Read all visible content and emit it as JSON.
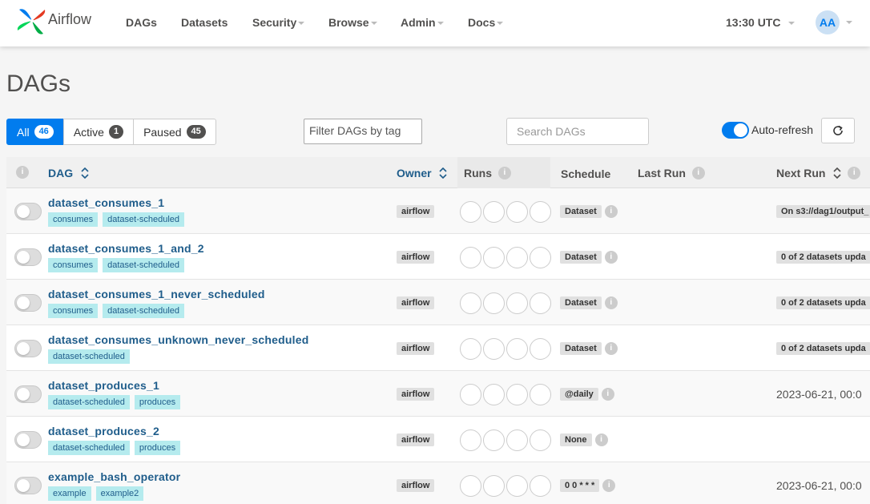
{
  "brand": {
    "name": "Airflow"
  },
  "nav": {
    "items": [
      {
        "label": "DAGs",
        "dropdown": false
      },
      {
        "label": "Datasets",
        "dropdown": false
      },
      {
        "label": "Security",
        "dropdown": true
      },
      {
        "label": "Browse",
        "dropdown": true
      },
      {
        "label": "Admin",
        "dropdown": true
      },
      {
        "label": "Docs",
        "dropdown": true
      }
    ],
    "clock": "13:30 UTC",
    "avatar_initials": "AA"
  },
  "page": {
    "title": "DAGs"
  },
  "filters": {
    "status": [
      {
        "label": "All",
        "count": "46",
        "active": true
      },
      {
        "label": "Active",
        "count": "1",
        "active": false
      },
      {
        "label": "Paused",
        "count": "45",
        "active": false
      }
    ],
    "tag_placeholder": "Filter DAGs by tag",
    "search_placeholder": "Search DAGs",
    "auto_refresh_label": "Auto-refresh",
    "auto_refresh_on": true
  },
  "table": {
    "headers": {
      "info": "i",
      "dag": "DAG",
      "owner": "Owner",
      "runs": "Runs",
      "schedule": "Schedule",
      "last_run": "Last Run",
      "next_run": "Next Run"
    },
    "rows": [
      {
        "name": "dataset_consumes_1",
        "tags": [
          "consumes",
          "dataset-scheduled"
        ],
        "owner": "airflow",
        "schedule": "Dataset",
        "next_run": "On s3://dag1/output_",
        "next_run_badge": true
      },
      {
        "name": "dataset_consumes_1_and_2",
        "tags": [
          "consumes",
          "dataset-scheduled"
        ],
        "owner": "airflow",
        "schedule": "Dataset",
        "next_run": "0 of 2 datasets upda",
        "next_run_badge": true
      },
      {
        "name": "dataset_consumes_1_never_scheduled",
        "tags": [
          "consumes",
          "dataset-scheduled"
        ],
        "owner": "airflow",
        "schedule": "Dataset",
        "next_run": "0 of 2 datasets upda",
        "next_run_badge": true
      },
      {
        "name": "dataset_consumes_unknown_never_scheduled",
        "tags": [
          "dataset-scheduled"
        ],
        "owner": "airflow",
        "schedule": "Dataset",
        "next_run": "0 of 2 datasets upda",
        "next_run_badge": true
      },
      {
        "name": "dataset_produces_1",
        "tags": [
          "dataset-scheduled",
          "produces"
        ],
        "owner": "airflow",
        "schedule": "@daily",
        "next_run": "2023-06-21, 00:0",
        "next_run_badge": false
      },
      {
        "name": "dataset_produces_2",
        "tags": [
          "dataset-scheduled",
          "produces"
        ],
        "owner": "airflow",
        "schedule": "None",
        "next_run": "",
        "next_run_badge": false
      },
      {
        "name": "example_bash_operator",
        "tags": [
          "example",
          "example2"
        ],
        "owner": "airflow",
        "schedule": "0 0 * * *",
        "next_run": "2023-06-21, 00:0",
        "next_run_badge": false
      }
    ]
  },
  "colors": {
    "primary": "#017cee",
    "dag_link": "#1f5d8b",
    "tag_bg": "#b5ebee"
  }
}
